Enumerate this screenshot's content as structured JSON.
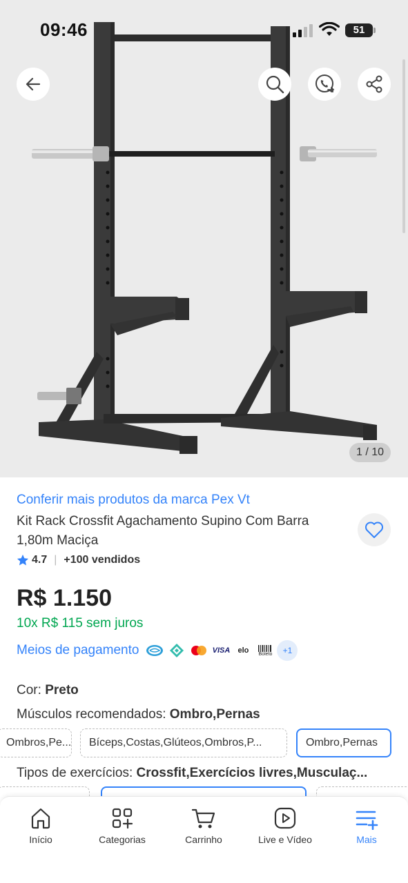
{
  "status": {
    "time": "09:46",
    "battery": "51"
  },
  "gallery": {
    "counter": "1 / 10"
  },
  "product": {
    "brand_link": "Conferir mais produtos da marca Pex Vt",
    "title": "Kit Rack Crossfit Agachamento Supino Com Barra 1,80m Maciça",
    "rating": "4.7",
    "sold": "+100 vendidos",
    "price": "R$ 1.150",
    "installments": "10x R$ 115 sem juros"
  },
  "payment": {
    "label": "Meios de pagamento",
    "icons": [
      "mercado-pago-icon",
      "pix-icon",
      "mastercard-icon",
      "visa-icon",
      "elo-icon",
      "boleto-icon"
    ],
    "visa": "VISA",
    "elo": "elo",
    "boleto": "Boleto",
    "more": "+1"
  },
  "attributes": {
    "color_label": "Cor: ",
    "color_value": "Preto",
    "muscles_label": "Músculos recomendados: ",
    "muscles_value": "Ombro,Pernas",
    "muscle_options": [
      "Ombros,Pe...",
      "Bíceps,Costas,Glúteos,Ombros,P...",
      "Ombro,Pernas"
    ],
    "types_label": "Tipos de exercícios: ",
    "types_value": "Crossfit,Exercícios livres,Musculaç..."
  },
  "nav": [
    {
      "label": "Início",
      "icon": "home-icon"
    },
    {
      "label": "Categorias",
      "icon": "categories-icon"
    },
    {
      "label": "Carrinho",
      "icon": "cart-icon"
    },
    {
      "label": "Live e Vídeo",
      "icon": "play-icon"
    },
    {
      "label": "Mais",
      "icon": "menu-add-icon"
    }
  ],
  "colors": {
    "accent": "#3483fa",
    "green": "#00a650",
    "text": "#333333",
    "hero_bg": "#ebebeb"
  }
}
